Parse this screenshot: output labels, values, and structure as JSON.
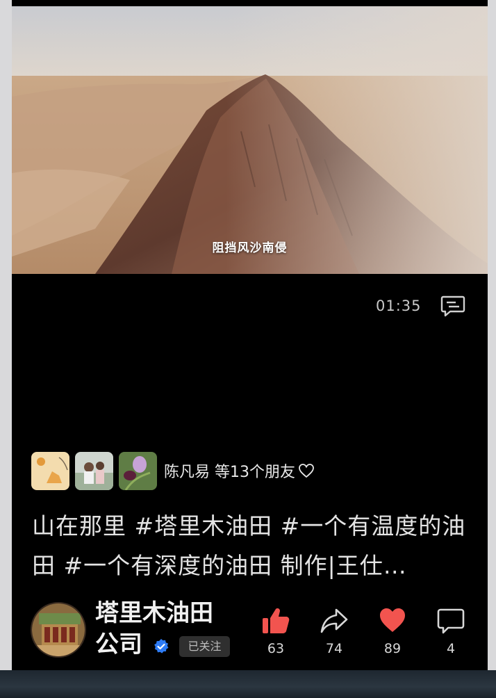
{
  "video": {
    "subtitle": "阻挡风沙南侵",
    "duration": "01:35"
  },
  "friends": {
    "text": "陈凡易 等13个朋友"
  },
  "caption": "山在那里 #塔里木油田 #一个有温度的油田 #一个有深度的油田 制作|王仕…",
  "author": {
    "name": "塔里木油田公司",
    "follow_status": "已关注"
  },
  "actions": {
    "like_count": "63",
    "share_count": "74",
    "favorite_count": "89",
    "comment_count": "4"
  },
  "colors": {
    "like": "#f2544f",
    "favorite": "#f2544f",
    "verified": "#2e7cf6"
  },
  "icons": [
    "danmaku-icon",
    "heart-outline-icon",
    "thumbs-up-icon",
    "share-icon",
    "heart-icon",
    "comment-icon",
    "verified-icon"
  ]
}
